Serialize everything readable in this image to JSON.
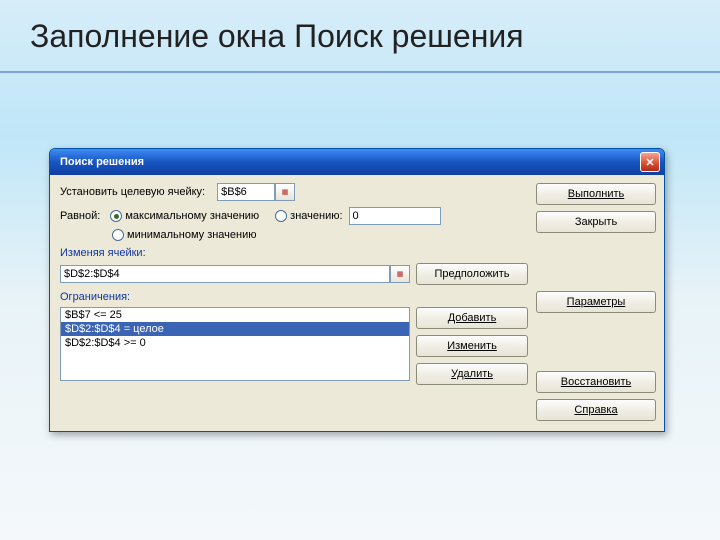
{
  "slide": {
    "title": "Заполнение окна Поиск решения"
  },
  "dialog": {
    "title": "Поиск решения",
    "target_label": "Установить целевую ячейку:",
    "target_value": "$B$6",
    "equal_label": "Равной:",
    "radio_max": "максимальному значению",
    "radio_min": "минимальному значению",
    "radio_val": "значению:",
    "val_value": "0",
    "changing_label": "Изменяя ячейки:",
    "changing_value": "$D$2:$D$4",
    "assume_btn": "Предположить",
    "constraints_label": "Ограничения:",
    "constraints": [
      "$B$7 <= 25",
      "$D$2:$D$4 = целое",
      "$D$2:$D$4 >= 0"
    ],
    "selected_constraint_index": 1,
    "btn_add": "Добавить",
    "btn_change": "Изменить",
    "btn_delete": "Удалить"
  },
  "side": {
    "execute": "Выполнить",
    "close": "Закрыть",
    "options": "Параметры",
    "reset": "Восстановить",
    "help": "Справка"
  }
}
